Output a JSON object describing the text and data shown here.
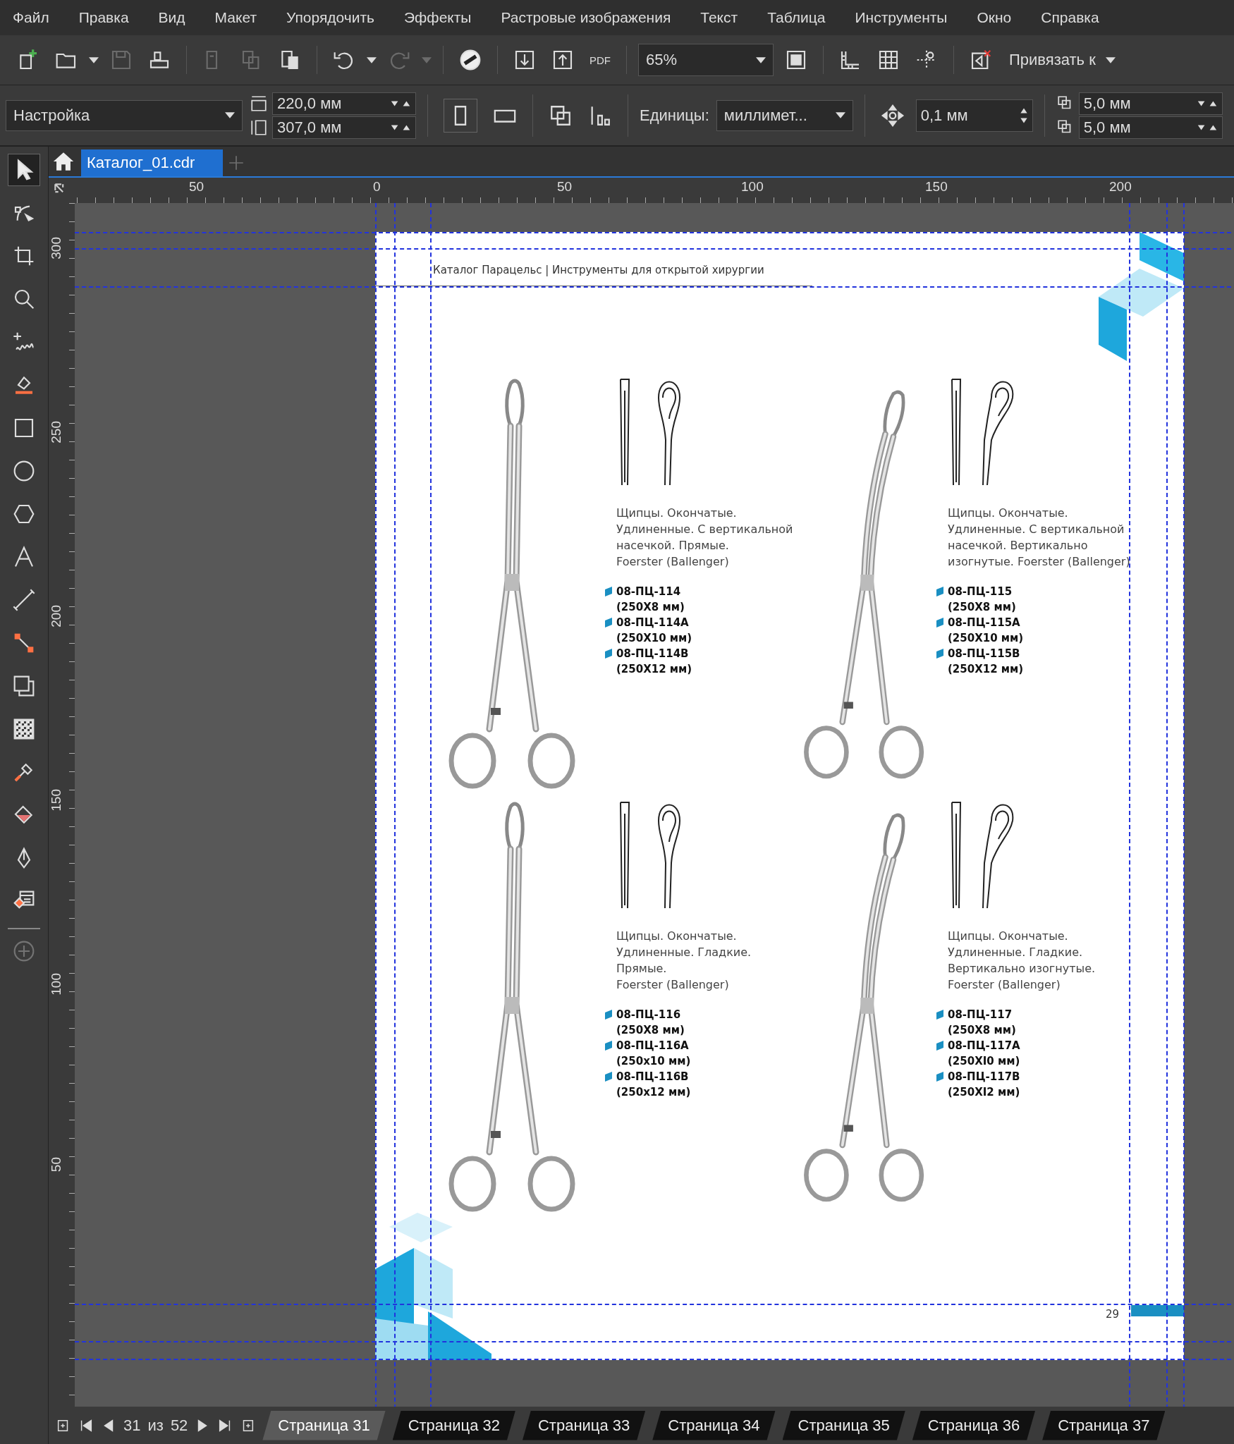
{
  "menu": [
    "Файл",
    "Правка",
    "Вид",
    "Макет",
    "Упорядочить",
    "Эффекты",
    "Растровые изображения",
    "Текст",
    "Таблица",
    "Инструменты",
    "Окно",
    "Справка"
  ],
  "toolbar": {
    "buttons": [
      {
        "kind": "new",
        "disabled": false
      },
      {
        "kind": "open",
        "disabled": false
      },
      {
        "kind": "save",
        "disabled": true
      },
      {
        "kind": "print",
        "disabled": false
      },
      {
        "kind": "cut",
        "disabled": true
      },
      {
        "kind": "copy",
        "disabled": true
      },
      {
        "kind": "paste",
        "disabled": false
      },
      {
        "kind": "undo",
        "disabled": false
      },
      {
        "kind": "redo",
        "disabled": true
      },
      {
        "kind": "launch",
        "disabled": false
      },
      {
        "kind": "import",
        "disabled": false
      },
      {
        "kind": "export",
        "disabled": false
      }
    ],
    "pdf_label": "PDF",
    "zoom": "65%",
    "snap": "Привязать к"
  },
  "property_bar": {
    "preset": "Настройка",
    "width": "220,0 мм",
    "height": "307,0 мм",
    "units_label": "Единицы:",
    "units": "миллимет...",
    "nudge": "0,1 мм",
    "dup_x": "5,0 мм",
    "dup_y": "5,0 мм"
  },
  "tools": [
    {
      "kind": "pointer",
      "selected": true
    },
    {
      "kind": "node",
      "selected": false
    },
    {
      "kind": "crop",
      "selected": false
    },
    {
      "kind": "zoom",
      "selected": false
    },
    {
      "kind": "freehand",
      "selected": false
    },
    {
      "kind": "smartfill",
      "selected": false
    },
    {
      "kind": "rect",
      "selected": false
    },
    {
      "kind": "ellipse",
      "selected": false
    },
    {
      "kind": "polygon",
      "selected": false
    },
    {
      "kind": "text",
      "selected": false
    },
    {
      "kind": "dimension",
      "selected": false
    },
    {
      "kind": "connector",
      "selected": false
    },
    {
      "kind": "shadow",
      "selected": false
    },
    {
      "kind": "transparency",
      "selected": false
    },
    {
      "kind": "eyedropper",
      "selected": false
    },
    {
      "kind": "fill",
      "selected": false
    },
    {
      "kind": "outline",
      "selected": false
    },
    {
      "kind": "interactive",
      "selected": false
    }
  ],
  "document_tabs": [
    {
      "label": "Каталог_01.cdr",
      "selected": true
    }
  ],
  "ruler": {
    "x_labels": [
      "50",
      "0",
      "50",
      "100",
      "150",
      "200"
    ],
    "y_labels": [
      "300",
      "250",
      "200",
      "150",
      "100",
      "50"
    ]
  },
  "page": {
    "header": "Каталог Парацельс | Инструменты для открытой хирургии",
    "page_number": "29",
    "products": [
      {
        "kind": "straight",
        "description": [
          "Щипцы. Окончатые.",
          "Удлиненные. С вертикальной",
          "насечкой. Прямые.",
          "Foerster (Ballenger)"
        ],
        "codes": [
          {
            "code": "08-ПЦ-114",
            "size": "(250X8 мм)"
          },
          {
            "code": "08-ПЦ-114А",
            "size": "(250X10 мм)"
          },
          {
            "code": "08-ПЦ-114В",
            "size": "(250X12 мм)"
          }
        ]
      },
      {
        "kind": "curved",
        "description": [
          "Щипцы. Окончатые.",
          "Удлиненные. С вертикальной",
          "насечкой. Вертикально",
          "изогнутые. Foerster (Ballenger)"
        ],
        "codes": [
          {
            "code": "08-ПЦ-115",
            "size": "(250X8 мм)"
          },
          {
            "code": "08-ПЦ-115А",
            "size": "(250X10 мм)"
          },
          {
            "code": "08-ПЦ-115В",
            "size": "(250X12 мм)"
          }
        ]
      },
      {
        "kind": "straight",
        "description": [
          "Щипцы. Окончатые.",
          "Удлиненные. Гладкие.",
          "Прямые.",
          "Foerster (Ballenger)"
        ],
        "codes": [
          {
            "code": "08-ПЦ-116",
            "size": "(250X8 мм)"
          },
          {
            "code": "08-ПЦ-116А",
            "size": "(250x10 мм)"
          },
          {
            "code": "08-ПЦ-116В",
            "size": "(250x12 мм)"
          }
        ]
      },
      {
        "kind": "curved",
        "description": [
          "Щипцы. Окончатые.",
          "Удлиненные. Гладкие.",
          "Вертикально изогнутые.",
          "Foerster (Ballenger)"
        ],
        "codes": [
          {
            "code": "08-ПЦ-117",
            "size": "(250X8 мм)"
          },
          {
            "code": "08-ПЦ-117А",
            "size": "(250XI0 мм)"
          },
          {
            "code": "08-ПЦ-117В",
            "size": "(250XI2 мм)"
          }
        ]
      }
    ]
  },
  "page_nav": {
    "current": "31",
    "of": "из",
    "total": "52",
    "tabs": [
      {
        "label": "Страница 31",
        "selected": true
      },
      {
        "label": "Страница 32",
        "selected": false
      },
      {
        "label": "Страница 33",
        "selected": false
      },
      {
        "label": "Страница 34",
        "selected": false
      },
      {
        "label": "Страница 35",
        "selected": false
      },
      {
        "label": "Страница 36",
        "selected": false
      },
      {
        "label": "Страница 37",
        "selected": false
      }
    ]
  }
}
